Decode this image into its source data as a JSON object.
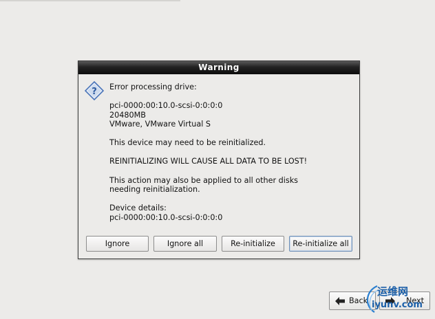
{
  "dialog": {
    "title": "Warning",
    "messages": [
      "Error processing drive:",
      "pci-0000:00:10.0-scsi-0:0:0:0\n20480MB\nVMware, VMware Virtual S",
      "This device may need to be reinitialized.",
      "REINITIALIZING WILL CAUSE ALL DATA TO BE LOST!",
      "This action may also be applied to all other disks\nneeding reinitialization.",
      "Device details:\npci-0000:00:10.0-scsi-0:0:0:0"
    ],
    "icon": "question-icon",
    "buttons": {
      "ignore": "Ignore",
      "ignore_all": "Ignore all",
      "reinitialize": "Re-initialize",
      "reinitialize_all": "Re-initialize all"
    }
  },
  "nav": {
    "back": "Back",
    "next": "Next"
  },
  "watermark": {
    "text_cn": "运维网",
    "text_en": "iyunv.com"
  },
  "colors": {
    "background": "#ecebe9",
    "titlebar": "#1a1a1a",
    "icon_blue": "#4a74b8"
  }
}
